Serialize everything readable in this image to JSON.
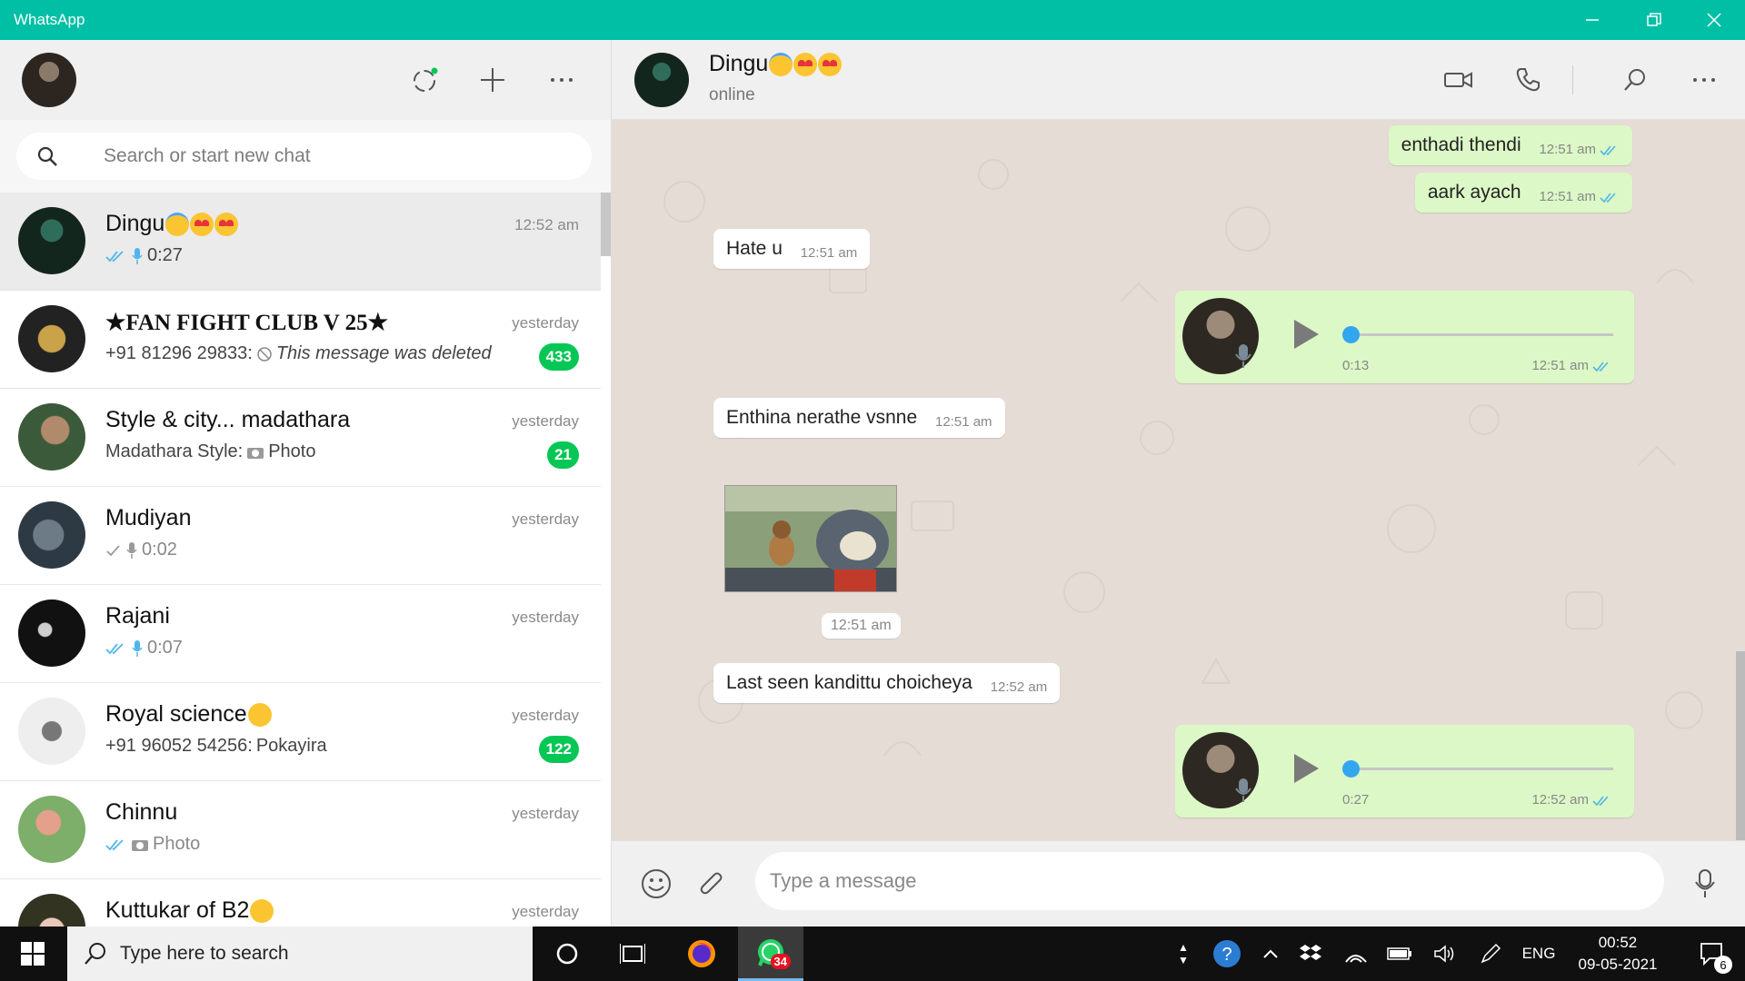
{
  "window": {
    "title": "WhatsApp"
  },
  "sidebar": {
    "search_placeholder": "Search or start new chat",
    "chats": [
      {
        "name": "Dingu",
        "emojis": [
          "halo",
          "heart",
          "heart"
        ],
        "time": "12:52 am",
        "preview": "0:27",
        "preview_icons": [
          "double-tick-blue",
          "mic-blue"
        ],
        "unread": null
      },
      {
        "name": "★FAN FIGHT CLUB V 25★",
        "emojis": [],
        "time": "yesterday",
        "preview_sender": "+91 81296 29833: ",
        "preview": "This message was deleted",
        "preview_icons": [
          "deleted"
        ],
        "unread": "433"
      },
      {
        "name": "Style & city... madathara",
        "emojis": [],
        "time": "yesterday",
        "preview_sender": "Madathara Style: ",
        "preview": "Photo",
        "preview_icons": [
          "camera"
        ],
        "unread": "21"
      },
      {
        "name": "Mudiyan",
        "emojis": [],
        "time": "yesterday",
        "preview": "0:02",
        "preview_icons": [
          "single-tick",
          "mic-gray"
        ],
        "unread": null
      },
      {
        "name": "Rajani",
        "emojis": [],
        "time": "yesterday",
        "preview": "0:07",
        "preview_icons": [
          "double-tick-blue",
          "mic-blue"
        ],
        "unread": null
      },
      {
        "name": "Royal science",
        "emojis": [
          "grin"
        ],
        "time": "yesterday",
        "preview_sender": "+91 96052 54256: ",
        "preview": "Pokayira",
        "preview_icons": [],
        "unread": "122"
      },
      {
        "name": "Chinnu",
        "emojis": [],
        "time": "yesterday",
        "preview": "Photo",
        "preview_icons": [
          "double-tick-blue",
          "camera"
        ],
        "unread": null
      },
      {
        "name": "Kuttukar of B2",
        "emojis": [
          "party"
        ],
        "time": "yesterday",
        "preview": "",
        "preview_icons": [],
        "unread": null
      }
    ]
  },
  "conversation": {
    "contact_name": "Dingu",
    "contact_status": "online",
    "messages": [
      {
        "type": "text",
        "dir": "out",
        "text": "enthadi thendi",
        "time": "12:51 am"
      },
      {
        "type": "text",
        "dir": "out",
        "text": "aark ayach",
        "time": "12:51 am"
      },
      {
        "type": "text",
        "dir": "in",
        "text": "Hate u",
        "time": "12:51 am"
      },
      {
        "type": "voice",
        "dir": "out",
        "duration": "0:13",
        "time": "12:51 am",
        "progress": 0
      },
      {
        "type": "text",
        "dir": "in",
        "text": "Enthina nerathe vsnne",
        "time": "12:51 am"
      },
      {
        "type": "sticker",
        "dir": "in",
        "time": "12:51 am"
      },
      {
        "type": "text",
        "dir": "in",
        "text": "Last seen kandittu choicheya",
        "time": "12:52 am"
      },
      {
        "type": "voice",
        "dir": "out",
        "duration": "0:27",
        "time": "12:52 am",
        "progress": 0
      }
    ],
    "composer_placeholder": "Type a message"
  },
  "taskbar": {
    "search_text": "Type here to search",
    "whatsapp_badge": "34",
    "language": "ENG",
    "time": "00:52",
    "date": "09-05-2021",
    "notifications": "6"
  },
  "colors": {
    "titlebar": "#00bfa5",
    "bubble_out": "#dcf8c6",
    "bubble_in": "#ffffff",
    "chat_bg": "#e5ddd5",
    "unread_badge": "#06c755",
    "tick_blue": "#4fb6ec"
  }
}
